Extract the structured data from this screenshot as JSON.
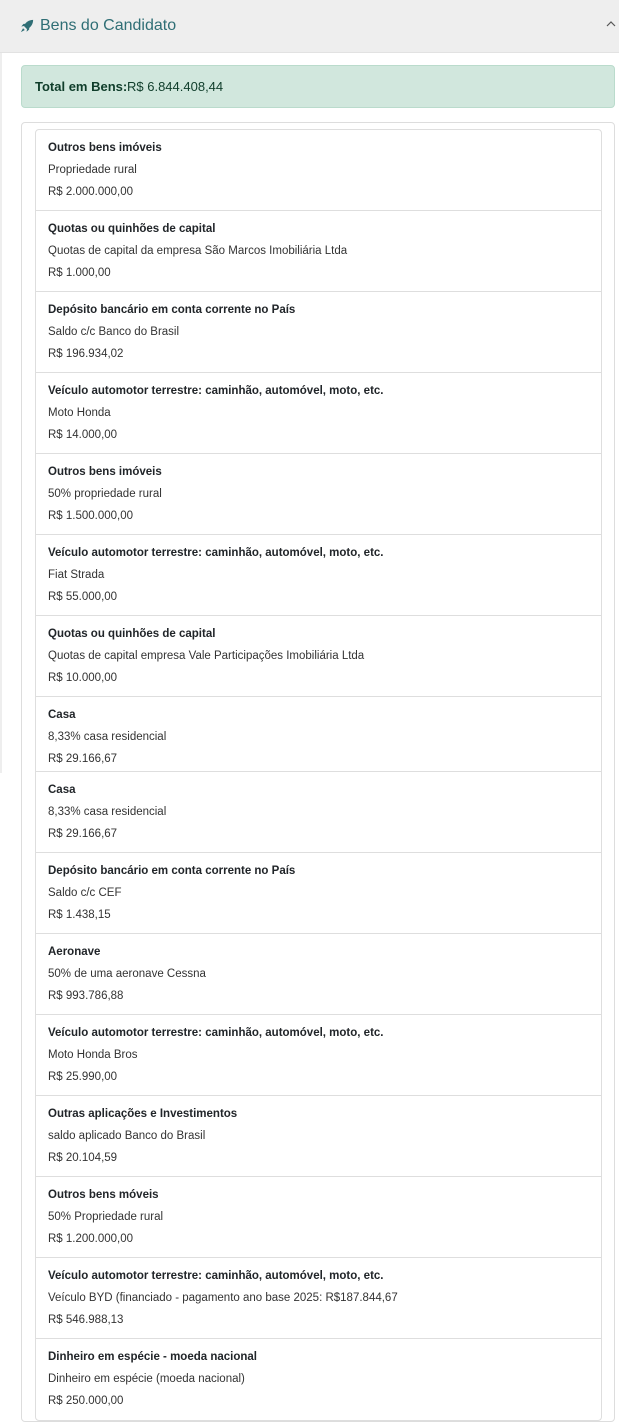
{
  "panel": {
    "title": "Bens do Candidato",
    "title_icon": "rocket-icon",
    "collapse_icon": "chevron-up-icon",
    "accent_color": "#2f6e75"
  },
  "total": {
    "label": "Total em Bens:",
    "value": "R$ 6.844.408,44",
    "background_color": "#d1e7dd"
  },
  "assets": [
    {
      "type": "Outros bens imóveis",
      "description": "Propriedade rural",
      "value": "R$ 2.000.000,00"
    },
    {
      "type": "Quotas ou quinhões de capital",
      "description": "Quotas de capital da empresa São Marcos Imobiliária Ltda",
      "value": "R$ 1.000,00"
    },
    {
      "type": "Depósito bancário em conta corrente no País",
      "description": "Saldo c/c Banco do Brasil",
      "value": "R$ 196.934,02"
    },
    {
      "type": "Veículo automotor terrestre: caminhão, automóvel, moto, etc.",
      "description": "Moto Honda",
      "value": "R$ 14.000,00"
    },
    {
      "type": "Outros bens imóveis",
      "description": "50% propriedade rural",
      "value": "R$ 1.500.000,00"
    },
    {
      "type": "Veículo automotor terrestre: caminhão, automóvel, moto, etc.",
      "description": "Fiat Strada",
      "value": "R$ 55.000,00"
    },
    {
      "type": "Quotas ou quinhões de capital",
      "description": "Quotas de capital empresa Vale Participações Imobiliária Ltda",
      "value": "R$ 10.000,00"
    },
    {
      "type": "Casa",
      "description": "8,33% casa residencial",
      "value": "R$ 29.166,67"
    },
    {
      "type": "Casa",
      "description": "8,33% casa residencial",
      "value": "R$ 29.166,67"
    },
    {
      "type": "Depósito bancário em conta corrente no País",
      "description": "Saldo c/c CEF",
      "value": "R$ 1.438,15"
    },
    {
      "type": "Aeronave",
      "description": "50% de uma aeronave Cessna",
      "value": "R$ 993.786,88"
    },
    {
      "type": "Veículo automotor terrestre: caminhão, automóvel, moto, etc.",
      "description": "Moto Honda Bros",
      "value": "R$ 25.990,00"
    },
    {
      "type": "Outras aplicações e Investimentos",
      "description": "saldo aplicado Banco do Brasil",
      "value": "R$ 20.104,59"
    },
    {
      "type": "Outros bens móveis",
      "description": "50% Propriedade rural",
      "value": "R$ 1.200.000,00"
    },
    {
      "type": "Veículo automotor terrestre: caminhão, automóvel, moto, etc.",
      "description": "Veículo BYD (financiado - pagamento ano base 2025: R$187.844,67",
      "value": "R$ 546.988,13"
    },
    {
      "type": "Dinheiro em espécie - moeda nacional",
      "description": "Dinheiro em espécie (moeda nacional)",
      "value": "R$ 250.000,00"
    }
  ]
}
